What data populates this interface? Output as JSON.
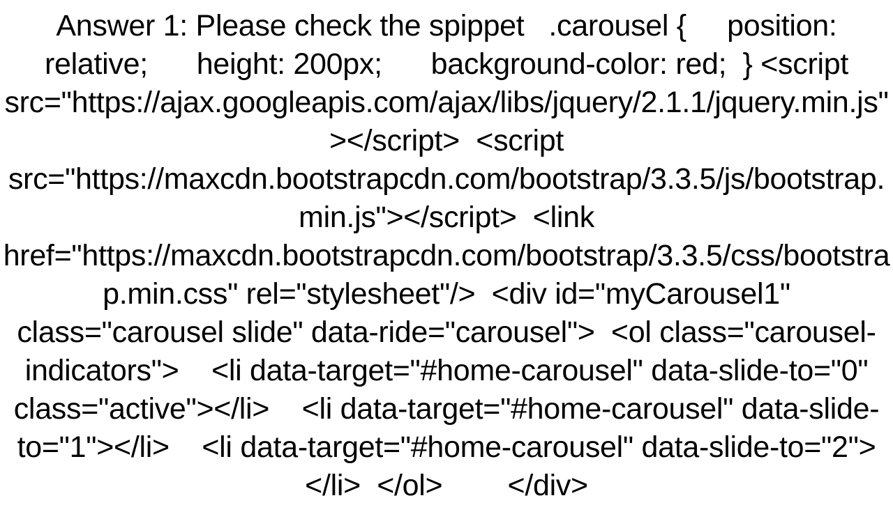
{
  "answer": {
    "text": "Answer 1: Please check the spippet   .carousel {     position: relative;      height: 200px;      background-color: red;  } <script src=\"https://ajax.googleapis.com/ajax/libs/jquery/2.1.1/jquery.min.js\"></script>  <script src=\"https://maxcdn.bootstrapcdn.com/bootstrap/3.3.5/js/bootstrap.min.js\"></script>  <link href=\"https://maxcdn.bootstrapcdn.com/bootstrap/3.3.5/css/bootstrap.min.css\" rel=\"stylesheet\"/>  <div id=\"myCarousel1\" class=\"carousel slide\" data-ride=\"carousel\">  <ol class=\"carousel-indicators\">    <li data-target=\"#home-carousel\" data-slide-to=\"0\" class=\"active\"></li>    <li data-target=\"#home-carousel\" data-slide-to=\"1\"></li>    <li data-target=\"#home-carousel\" data-slide-to=\"2\"></li>  </ol>        </div>"
  }
}
